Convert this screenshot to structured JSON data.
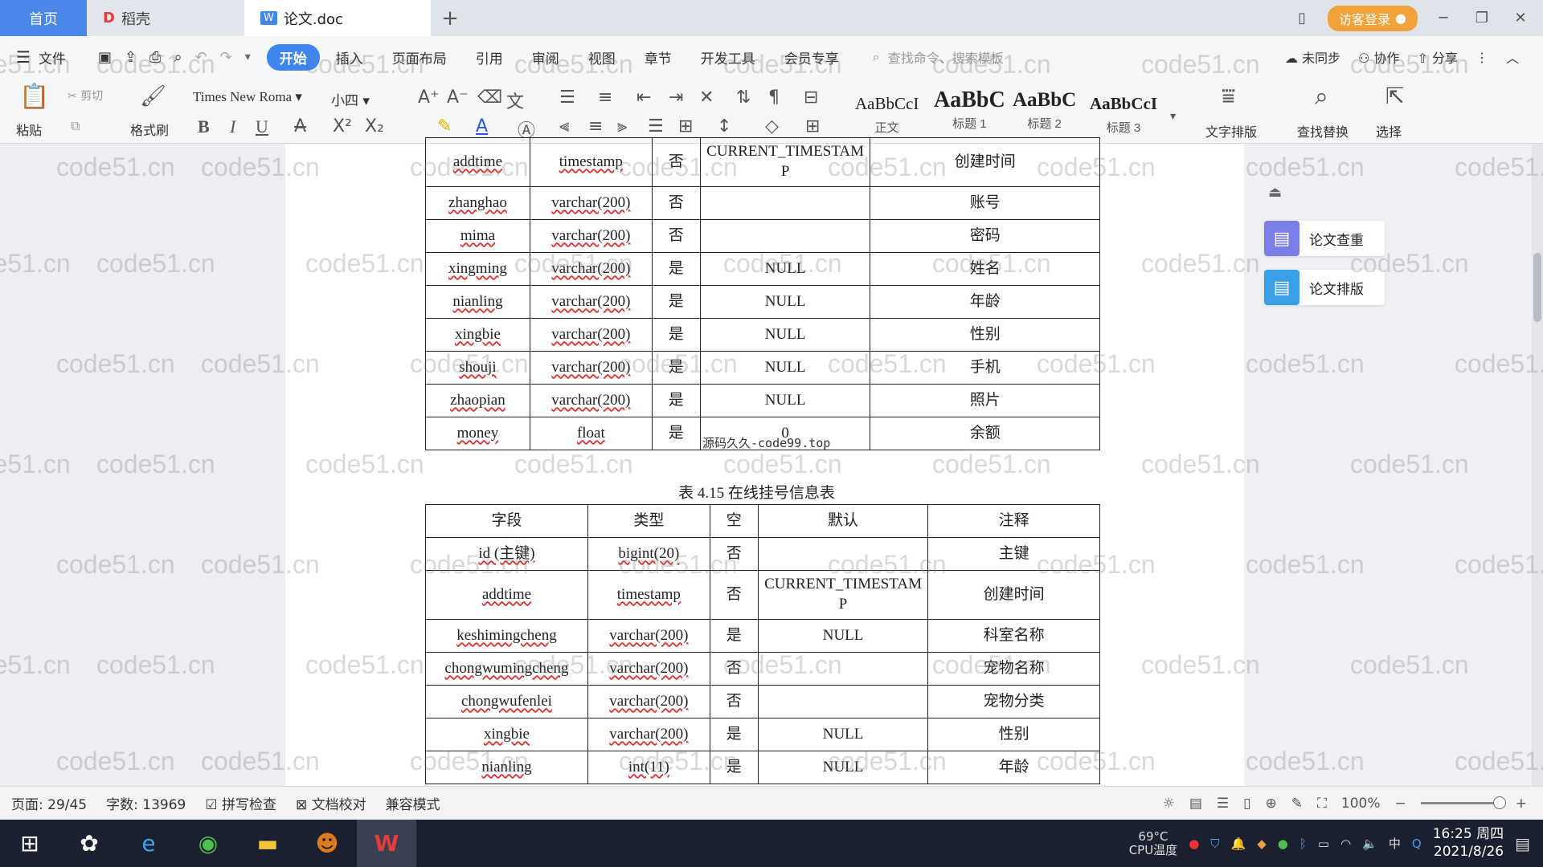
{
  "tabs": {
    "home": "首页",
    "daoke": "稻壳",
    "doc": "论文.doc",
    "visitor": "访客登录"
  },
  "menu": {
    "file": "文件",
    "items": [
      "开始",
      "插入",
      "页面布局",
      "引用",
      "审阅",
      "视图",
      "章节",
      "开发工具",
      "会员专享"
    ],
    "search_cmd": "查找命令、搜索模板",
    "right": [
      "未同步",
      "协作",
      "分享"
    ]
  },
  "ribbon": {
    "paste": "粘贴",
    "cut": "剪切",
    "format_painter": "格式刷",
    "font_name": "Times New Roma",
    "font_size": "小四",
    "styles": [
      {
        "preview": "AaBbCcI",
        "label": "正文"
      },
      {
        "preview": "AaBbC",
        "label": "标题 1"
      },
      {
        "preview": "AaBbC",
        "label": "标题 2"
      },
      {
        "preview": "AaBbCcI",
        "label": "标题 3"
      }
    ],
    "text_layout": "文字排版",
    "find_replace": "查找替换",
    "select": "选择"
  },
  "right_panel": {
    "check": "论文查重",
    "layout": "论文排版"
  },
  "table1": {
    "rows": [
      [
        "addtime",
        "timestamp",
        "否",
        "CURRENT_TIMESTAMP",
        "创建时间"
      ],
      [
        "zhanghao",
        "varchar(200)",
        "否",
        "",
        "账号"
      ],
      [
        "mima",
        "varchar(200)",
        "否",
        "",
        "密码"
      ],
      [
        "xingming",
        "varchar(200)",
        "是",
        "NULL",
        "姓名"
      ],
      [
        "nianling",
        "varchar(200)",
        "是",
        "NULL",
        "年龄"
      ],
      [
        "xingbie",
        "varchar(200)",
        "是",
        "NULL",
        "性别"
      ],
      [
        "shouji",
        "varchar(200)",
        "是",
        "NULL",
        "手机"
      ],
      [
        "zhaopian",
        "varchar(200)",
        "是",
        "NULL",
        "照片"
      ],
      [
        "money",
        "float",
        "是",
        "0",
        "余额"
      ]
    ]
  },
  "table2": {
    "caption": "表 4.15  在线挂号信息表",
    "header": [
      "字段",
      "类型",
      "空",
      "默认",
      "注释"
    ],
    "rows": [
      [
        "id (主键)",
        "bigint(20)",
        "否",
        "",
        "主键"
      ],
      [
        "addtime",
        "timestamp",
        "否",
        "CURRENT_TIMESTAMP",
        "创建时间"
      ],
      [
        "keshimingcheng",
        "varchar(200)",
        "是",
        "NULL",
        "科室名称"
      ],
      [
        "chongwumingcheng",
        "varchar(200)",
        "否",
        "",
        "宠物名称"
      ],
      [
        "chongwufenlei",
        "varchar(200)",
        "否",
        "",
        "宠物分类"
      ],
      [
        "xingbie",
        "varchar(200)",
        "是",
        "NULL",
        "性别"
      ],
      [
        "nianling",
        "int(11)",
        "是",
        "NULL",
        "年龄"
      ]
    ]
  },
  "watermark": "code51.cn",
  "watermark_inline": "源码久久-code99.top",
  "status": {
    "page": "页面: 29/45",
    "words": "字数: 13969",
    "spell": "拼写检查",
    "proof": "文档校对",
    "compat": "兼容模式",
    "zoom": "100%"
  },
  "taskbar": {
    "cpu_temp": "69°C",
    "cpu_label": "CPU温度",
    "ime": "中",
    "time": "16:25 周四",
    "date": "2021/8/26"
  }
}
